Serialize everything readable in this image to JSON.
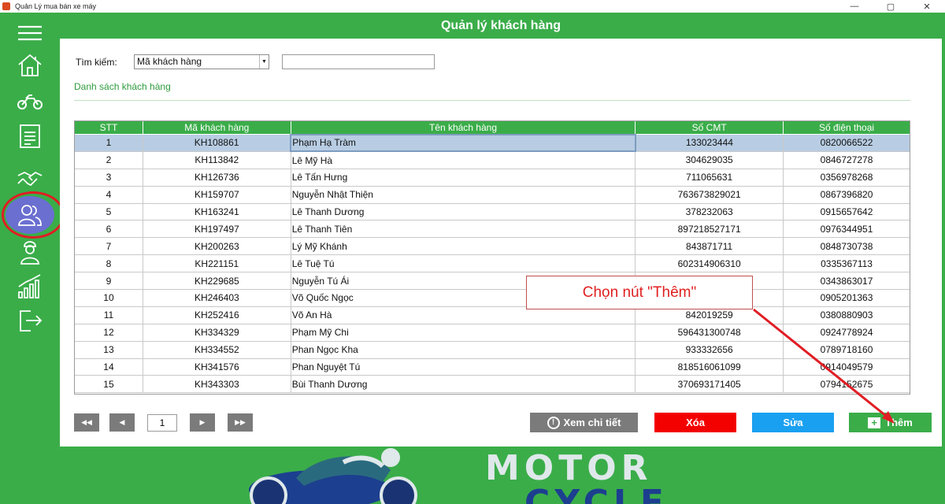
{
  "window": {
    "title": "Quản Lý mua bán xe máy",
    "controls": [
      "minimize",
      "maximize",
      "close"
    ]
  },
  "header": {
    "title": "Quản lý khách hàng"
  },
  "sidebar": {
    "items": [
      {
        "icon": "hamburger-menu-icon"
      },
      {
        "icon": "home-icon"
      },
      {
        "icon": "motorbike-icon"
      },
      {
        "icon": "invoice-icon"
      },
      {
        "icon": "handshake-icon"
      },
      {
        "icon": "customers-icon",
        "active": true
      },
      {
        "icon": "employee-icon"
      },
      {
        "icon": "statistics-chart-icon"
      },
      {
        "icon": "logout-icon"
      }
    ]
  },
  "search": {
    "label": "Tìm kiếm:",
    "selected_option": "Mã khách hàng",
    "value": ""
  },
  "list": {
    "title": "Danh sách khách hàng",
    "columns": [
      "STT",
      "Mã khách hàng",
      "Tên khách hàng",
      "Số CMT",
      "Số điện thoại"
    ],
    "rows": [
      [
        "1",
        "KH108861",
        "Phạm Hạ Tràm",
        "133023444",
        "0820066522"
      ],
      [
        "2",
        "KH113842",
        "Lê Mỹ Hà",
        "304629035",
        "0846727278"
      ],
      [
        "3",
        "KH126736",
        "Lê Tấn Hưng",
        "711065631",
        "0356978268"
      ],
      [
        "4",
        "KH159707",
        "Nguyễn Nhật Thiện",
        "763673829021",
        "0867396820"
      ],
      [
        "5",
        "KH163241",
        "Lê Thanh Dương",
        "378232063",
        "0915657642"
      ],
      [
        "6",
        "KH197497",
        "Lê Thanh Tiên",
        "897218527171",
        "0976344951"
      ],
      [
        "7",
        "KH200263",
        "Lý Mỹ Khánh",
        "843871711",
        "0848730738"
      ],
      [
        "8",
        "KH221151",
        "Lê Tuệ Tú",
        "602314906310",
        "0335367113"
      ],
      [
        "9",
        "KH229685",
        "Nguyễn Tú Ái",
        "",
        "0343863017"
      ],
      [
        "10",
        "KH246403",
        "Võ Quốc Ngọc",
        "",
        "0905201363"
      ],
      [
        "11",
        "KH252416",
        "Võ An Hà",
        "842019259",
        "0380880903"
      ],
      [
        "12",
        "KH334329",
        "Phạm Mỹ Chi",
        "596431300748",
        "0924778924"
      ],
      [
        "13",
        "KH334552",
        "Phan Ngọc Kha",
        "933332656",
        "0789718160"
      ],
      [
        "14",
        "KH341576",
        "Phan Nguyệt Tú",
        "818516061099",
        "0914049579"
      ],
      [
        "15",
        "KH343303",
        "Bùi Thanh Dương",
        "370693171405",
        "0794152675"
      ]
    ],
    "selected_row": 1
  },
  "pager": {
    "first": "◀◀",
    "prev": "◀",
    "page": "1",
    "next": "▶",
    "last": "▶▶"
  },
  "actions": {
    "detail": "Xem chi tiết",
    "delete": "Xóa",
    "edit": "Sửa",
    "add": "Thêm"
  },
  "annotation": {
    "callout_text": "Chọn nút \"Thêm\"",
    "color": "#e02020"
  },
  "banner": {
    "line1": "MOTOR",
    "line2": "CYCLE"
  },
  "colors": {
    "brand_green": "#3aad49",
    "delete_red": "#f30000",
    "edit_blue": "#1aa0f0",
    "neutral_gray": "#7b7b7b",
    "active_sidebar": "#6a6fd0"
  }
}
